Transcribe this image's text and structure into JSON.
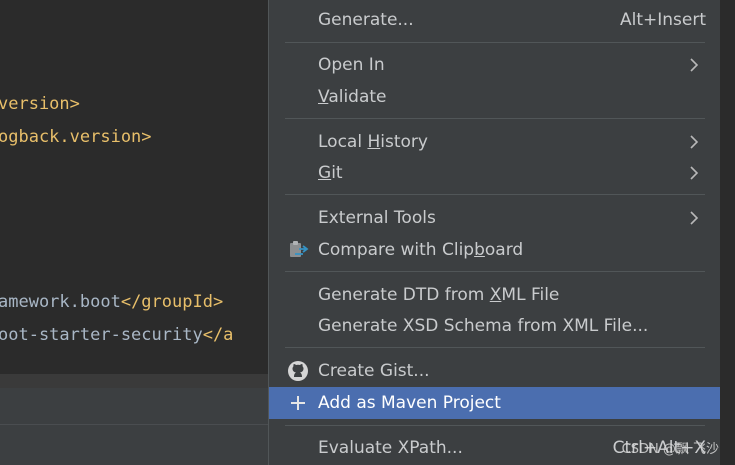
{
  "editor": {
    "lines": [
      {
        "tag1": "version>",
        "text": "",
        "tag2": ""
      },
      {
        "tag1": "ogback.version>",
        "text": "",
        "tag2": ""
      },
      {
        "tag1": "",
        "text": "amework.boot",
        "tag2": "</groupId>"
      },
      {
        "tag1": "",
        "text": "oot-starter-security",
        "tag2": "</a"
      }
    ]
  },
  "menu": {
    "items": [
      {
        "label": "Generate...",
        "shortcut": "Alt+Insert"
      },
      {
        "label": "Open In"
      },
      {
        "pre": "",
        "u": "V",
        "post": "alidate"
      },
      {
        "pre": "Local ",
        "u": "H",
        "post": "istory"
      },
      {
        "pre": "",
        "u": "G",
        "post": "it"
      },
      {
        "label": "External Tools"
      },
      {
        "pre": "Compare with Clip",
        "u": "b",
        "post": "oard"
      },
      {
        "pre": "Generate DTD from ",
        "u": "X",
        "post": "ML File"
      },
      {
        "label": "Generate XSD Schema from XML File..."
      },
      {
        "label": "Create Gist..."
      },
      {
        "label": "Add as Maven Project"
      },
      {
        "label": "Evaluate XPath...",
        "shortcut": "Ctrl+Alt+X"
      }
    ]
  },
  "watermark": "CSDN @飘 飞沙",
  "colors": {
    "menu_bg": "#3c3f41",
    "selected_bg": "#4b6eaf",
    "tag": "#e8bf6a",
    "text": "#a9b7c6"
  },
  "icons": [
    "chevron-right-icon",
    "compare-clipboard-icon",
    "github-icon",
    "plus-icon"
  ]
}
